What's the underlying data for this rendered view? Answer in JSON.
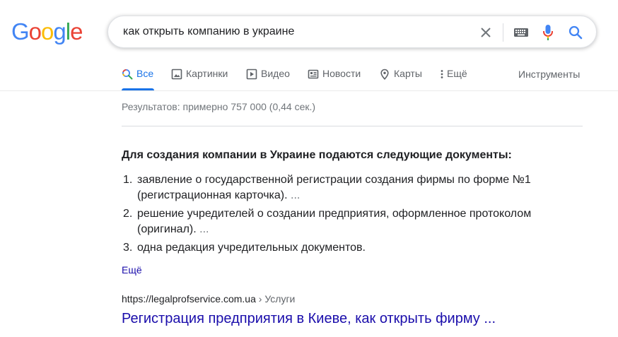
{
  "logo": {
    "letters": [
      "G",
      "o",
      "o",
      "g",
      "l",
      "e"
    ],
    "colors": [
      "#4285f4",
      "#ea4335",
      "#fbbc05",
      "#4285f4",
      "#34a853",
      "#ea4335"
    ]
  },
  "search": {
    "query": "как открыть компанию в украине"
  },
  "tabs": [
    {
      "label": "Все",
      "icon": "search-icon",
      "active": true
    },
    {
      "label": "Картинки",
      "icon": "image-icon"
    },
    {
      "label": "Видео",
      "icon": "play-icon"
    },
    {
      "label": "Новости",
      "icon": "news-icon"
    },
    {
      "label": "Карты",
      "icon": "map-pin-icon"
    },
    {
      "label": "Ещё",
      "icon": "more-vert-icon"
    }
  ],
  "tools_label": "Инструменты",
  "stats": "Результатов: примерно 757 000 (0,44 сек.)",
  "snippet": {
    "heading": "Для создания компании в Украине подаются следующие документы:",
    "items": [
      {
        "num": "1.",
        "line1": "заявление о государственной регистрации создания фирмы по форме №1",
        "line2": "(регистрационная карточка).",
        "ellipsis": "..."
      },
      {
        "num": "2.",
        "line1": "решение учредителей о создании предприятия, оформленное протоколом",
        "line2": "(оригинал).",
        "ellipsis": "..."
      },
      {
        "num": "3.",
        "line1": "одна редакция учредительных документов."
      }
    ],
    "more": "Ещё"
  },
  "result": {
    "url": "https://legalprofservice.com.ua",
    "breadcrumb": " › Услуги",
    "title": "Регистрация предприятия в Киеве, как открыть фирму ..."
  },
  "colors": {
    "link": "#1a0dab",
    "accent": "#1a73e8",
    "muted": "#70757a"
  }
}
